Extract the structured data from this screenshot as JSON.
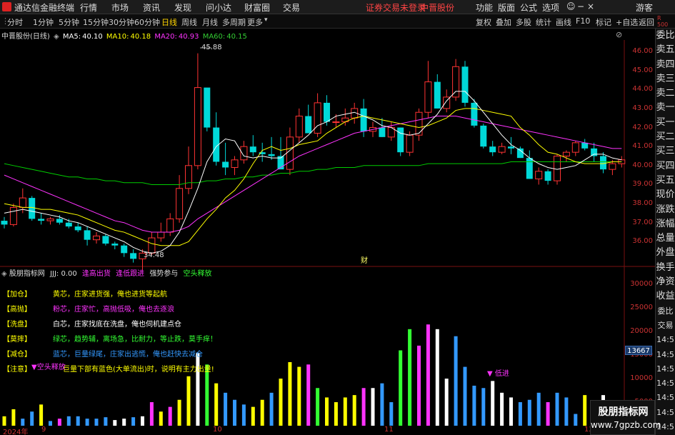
{
  "topbar": {
    "app_title": "通达信金融终端",
    "menus": [
      "行情",
      "市场",
      "资讯",
      "发现",
      "问小达",
      "财富圈",
      "交易"
    ],
    "login_notice": "证券交易未登录",
    "stock_name": "中晋股份",
    "right_menus": [
      "功能",
      "版面",
      "公式",
      "选项"
    ],
    "guest": "游客"
  },
  "tabbar": {
    "periods": [
      "分时",
      "1分钟",
      "5分钟",
      "15分钟",
      "30分钟",
      "60分钟",
      "日线",
      "周线",
      "月线",
      "多周期",
      "更多"
    ],
    "active_period": "日线",
    "right_buttons": [
      "复权",
      "叠加",
      "多股",
      "统计",
      "画线",
      "F10",
      "标记",
      "+自选",
      "返回"
    ]
  },
  "indicator_line": {
    "stock": "中晋股份(日线)",
    "ma5_label": "MA5:",
    "ma5": "40.10",
    "ma10_label": "MA10:",
    "ma10": "40.18",
    "ma20_label": "MA20:",
    "ma20": "40.93",
    "ma60_label": "MA60:",
    "ma60": "40.15"
  },
  "price_axis": [
    "46.00",
    "45.00",
    "44.00",
    "43.00",
    "42.00",
    "41.00",
    "40.00",
    "39.00",
    "38.00",
    "37.00",
    "36.00"
  ],
  "annotations": {
    "high": "45.88",
    "low": "34.48",
    "marker": "财"
  },
  "sub_panel": {
    "title": "股朋指标网",
    "jjj": "JJJ: 0.00",
    "s1": "逢高出货",
    "s2": "逢低跟进",
    "s3": "强势参与",
    "s4": "空头释放",
    "axis": [
      "30000",
      "25000",
      "20000",
      "15000",
      "10000",
      "5000"
    ],
    "highlight_value": "13667",
    "pointer_label": "低进",
    "pointer_label2": "空头释放"
  },
  "legend": [
    {
      "key": "【加仓】",
      "text": "黄芯，庄家进货强，俺也进货等起航",
      "color": "#ffff00"
    },
    {
      "key": "【高抛】",
      "text": "粉芯，庄家忙，高抛低吸，俺也去逐浪",
      "color": "#ff33ff"
    },
    {
      "key": "【洗盘】",
      "text": "白芯，庄家找底在洗盘，俺也伺机建点仓",
      "color": "#ffffff"
    },
    {
      "key": "【莫摔】",
      "text": "绿芯，趋势辅，离场急，比耐力，等止跌，莫手痒！",
      "color": "#33ff33"
    },
    {
      "key": "【减仓】",
      "text": "蓝芯，巨量绿尾，庄家出逃慌，俺也赶快去减仓",
      "color": "#3399ff"
    },
    {
      "key": "【注意】",
      "text": "巨量下部有蓝色(大单流出)时，说明有主力出量!",
      "color": "#ffff00"
    }
  ],
  "right_panel": [
    "委比",
    "卖五",
    "卖四",
    "卖三",
    "卖二",
    "卖一",
    "买一",
    "买二",
    "买三",
    "买四",
    "买五",
    "现价",
    "涨跌",
    "涨幅",
    "总量",
    "外盘",
    "换手",
    "净资",
    "收益"
  ],
  "right_panel2": [
    "委比",
    "交易",
    "14:5",
    "14:5",
    "14:5",
    "14:5",
    "14:5",
    "14:5",
    "14:5",
    "14:5"
  ],
  "dates": {
    "d1": "2024年",
    "m9": "9",
    "m10": "10",
    "m11": "11",
    "m12": "12"
  },
  "watermark": {
    "line1": "股朋指标网",
    "line2": "www.7gpzb.com"
  },
  "colors": {
    "up": "#ff3333",
    "down": "#00d8d8",
    "ma5": "#ffffff",
    "ma10": "#ffff00",
    "ma20": "#ff33ff",
    "ma60": "#00cc00"
  },
  "chart_data": {
    "type": "candlestick",
    "ylim": [
      35.0,
      46.6
    ],
    "candles": [
      [
        37.1,
        37.3,
        36.7,
        36.9
      ],
      [
        36.9,
        38.0,
        36.8,
        37.8
      ],
      [
        37.8,
        38.8,
        37.5,
        38.3
      ],
      [
        38.3,
        38.4,
        37.1,
        37.2
      ],
      [
        37.2,
        37.5,
        36.9,
        37.1
      ],
      [
        37.1,
        37.3,
        36.9,
        37.2
      ],
      [
        37.2,
        37.4,
        36.9,
        37.0
      ],
      [
        37.0,
        37.2,
        36.7,
        36.8
      ],
      [
        36.8,
        37.0,
        36.5,
        36.6
      ],
      [
        36.6,
        36.8,
        35.8,
        36.1
      ],
      [
        36.1,
        36.5,
        35.9,
        36.3
      ],
      [
        36.3,
        36.4,
        35.8,
        35.9
      ],
      [
        35.9,
        36.0,
        35.6,
        35.8
      ],
      [
        35.8,
        35.9,
        35.2,
        35.4
      ],
      [
        35.4,
        35.6,
        34.9,
        35.1
      ],
      [
        35.1,
        35.6,
        34.5,
        35.4
      ],
      [
        35.4,
        36.5,
        35.3,
        36.2
      ],
      [
        36.2,
        37.0,
        36.0,
        36.5
      ],
      [
        36.5,
        37.5,
        36.3,
        37.2
      ],
      [
        37.2,
        39.5,
        37.0,
        38.8
      ],
      [
        38.8,
        41.0,
        38.5,
        40.0
      ],
      [
        40.0,
        45.9,
        39.8,
        44.1
      ],
      [
        44.1,
        42.5,
        41.8,
        42.0
      ],
      [
        42.0,
        42.8,
        40.0,
        40.2
      ],
      [
        40.2,
        41.2,
        39.5,
        39.9
      ],
      [
        39.9,
        40.5,
        39.5,
        40.3
      ],
      [
        40.3,
        41.3,
        40.1,
        41.0
      ],
      [
        41.0,
        41.6,
        40.5,
        40.7
      ],
      [
        40.7,
        41.2,
        40.2,
        40.6
      ],
      [
        40.6,
        41.5,
        40.3,
        40.5
      ],
      [
        40.5,
        41.5,
        39.9,
        39.8
      ],
      [
        39.8,
        42.0,
        39.5,
        41.5
      ],
      [
        41.5,
        43.0,
        41.2,
        42.6
      ],
      [
        42.6,
        43.2,
        42.0,
        41.7
      ],
      [
        41.7,
        43.8,
        41.5,
        43.3
      ],
      [
        43.3,
        43.7,
        42.1,
        42.3
      ],
      [
        42.3,
        42.7,
        42.0,
        42.3
      ],
      [
        42.3,
        43.0,
        42.1,
        42.5
      ],
      [
        42.5,
        43.3,
        42.2,
        43.0
      ],
      [
        43.0,
        43.5,
        41.5,
        41.8
      ],
      [
        41.8,
        42.3,
        41.5,
        42.0
      ],
      [
        42.0,
        42.5,
        41.5,
        41.5
      ],
      [
        41.5,
        42.3,
        41.3,
        42.0
      ],
      [
        42.0,
        42.0,
        40.5,
        40.7
      ],
      [
        40.7,
        41.8,
        40.5,
        41.6
      ],
      [
        41.6,
        43.0,
        41.3,
        42.8
      ],
      [
        42.8,
        45.5,
        42.5,
        44.4
      ],
      [
        44.4,
        44.8,
        43.0,
        43.0
      ],
      [
        43.0,
        44.0,
        42.8,
        43.6
      ],
      [
        43.6,
        45.6,
        43.4,
        45.2
      ],
      [
        45.2,
        45.5,
        43.1,
        43.3
      ],
      [
        43.3,
        43.5,
        42.0,
        42.1
      ],
      [
        42.1,
        42.2,
        40.9,
        41.0
      ],
      [
        41.0,
        41.3,
        40.5,
        40.7
      ],
      [
        40.7,
        41.2,
        40.6,
        41.0
      ],
      [
        41.0,
        41.5,
        40.6,
        40.9
      ],
      [
        40.9,
        41.0,
        40.4,
        40.4
      ],
      [
        40.4,
        40.8,
        39.3,
        39.3
      ],
      [
        39.3,
        39.9,
        39.0,
        39.7
      ],
      [
        39.7,
        39.8,
        39.0,
        39.2
      ],
      [
        39.2,
        40.6,
        39.0,
        40.5
      ],
      [
        40.5,
        40.8,
        40.2,
        40.7
      ],
      [
        40.7,
        41.3,
        40.5,
        41.2
      ],
      [
        41.2,
        41.4,
        40.8,
        40.9
      ],
      [
        40.9,
        41.2,
        40.2,
        40.5
      ],
      [
        40.5,
        40.7,
        39.6,
        39.8
      ],
      [
        39.8,
        40.3,
        39.5,
        40.1
      ],
      [
        40.1,
        40.5,
        39.9,
        40.3
      ]
    ],
    "ma5": [
      37.5,
      37.6,
      37.7,
      37.6,
      37.5,
      37.4,
      37.3,
      37.1,
      37.0,
      36.8,
      36.6,
      36.4,
      36.2,
      36.0,
      35.7,
      35.5,
      35.4,
      35.5,
      35.8,
      36.5,
      37.6,
      38.8,
      40.2,
      41.0,
      41.4,
      41.3,
      40.5,
      40.4,
      40.5,
      40.4,
      40.4,
      40.8,
      41.2,
      41.6,
      42.1,
      42.3,
      42.6,
      42.7,
      42.8,
      42.6,
      42.4,
      42.1,
      42.0,
      41.7,
      41.6,
      41.7,
      42.2,
      42.7,
      43.4,
      43.9,
      43.9,
      43.4,
      42.8,
      42.2,
      41.6,
      41.1,
      40.8,
      40.4,
      40.1,
      39.9,
      39.8,
      39.9,
      40.0,
      40.3,
      40.6,
      40.6,
      40.4,
      40.3
    ],
    "ma10": [
      38.0,
      37.9,
      37.8,
      37.8,
      37.7,
      37.7,
      37.6,
      37.5,
      37.4,
      37.2,
      37.0,
      36.8,
      36.6,
      36.5,
      36.3,
      36.1,
      35.9,
      35.8,
      35.8,
      35.8,
      36.0,
      36.6,
      37.2,
      37.7,
      38.3,
      38.7,
      39.3,
      40.1,
      40.8,
      41.0,
      40.8,
      40.9,
      41.1,
      41.2,
      41.3,
      41.7,
      42.0,
      42.3,
      42.5,
      42.6,
      42.5,
      42.4,
      42.3,
      42.2,
      42.1,
      42.0,
      42.1,
      42.3,
      42.5,
      42.9,
      43.0,
      43.0,
      42.9,
      42.8,
      42.7,
      42.6,
      42.0,
      41.6,
      41.1,
      40.7,
      40.6,
      40.4,
      40.2,
      40.1,
      40.1,
      40.1,
      40.2,
      40.2
    ],
    "ma20": [
      39.5,
      39.3,
      39.1,
      38.9,
      38.7,
      38.5,
      38.3,
      38.1,
      37.9,
      37.7,
      37.5,
      37.3,
      37.1,
      37.0,
      36.8,
      36.6,
      36.5,
      36.5,
      36.5,
      36.6,
      36.8,
      37.2,
      37.5,
      37.8,
      38.1,
      38.4,
      38.7,
      39.0,
      39.3,
      39.6,
      39.9,
      40.2,
      40.5,
      40.7,
      40.9,
      41.1,
      41.3,
      41.5,
      41.7,
      41.8,
      41.9,
      42.0,
      42.1,
      42.2,
      42.3,
      42.4,
      42.5,
      42.6,
      42.6,
      42.6,
      42.5,
      42.4,
      42.3,
      42.2,
      42.1,
      42.0,
      41.9,
      41.8,
      41.7,
      41.6,
      41.5,
      41.4,
      41.3,
      41.2,
      41.1,
      41.0,
      40.9,
      40.9
    ],
    "ma60": [
      40.1,
      40.0,
      39.9,
      39.8,
      39.7,
      39.6,
      39.5,
      39.4,
      39.4,
      39.3,
      39.3,
      39.2,
      39.2,
      39.1,
      39.1,
      39.1,
      39.0,
      39.0,
      39.0,
      39.0,
      39.1,
      39.1,
      39.2,
      39.2,
      39.3,
      39.3,
      39.4,
      39.4,
      39.5,
      39.5,
      39.6,
      39.6,
      39.7,
      39.7,
      39.8,
      39.8,
      39.9,
      39.9,
      39.9,
      40.0,
      40.0,
      40.0,
      40.0,
      40.0,
      40.0,
      40.0,
      40.1,
      40.1,
      40.1,
      40.1,
      40.1,
      40.1,
      40.1,
      40.1,
      40.1,
      40.2,
      40.2,
      40.2,
      40.2,
      40.2,
      40.2,
      40.2,
      40.2,
      40.2,
      40.2,
      40.2,
      40.2,
      40.2
    ],
    "volume_ylim": [
      0,
      32000
    ],
    "volume": [
      [
        2000,
        "#ffff00"
      ],
      [
        3500,
        "#ffff00"
      ],
      [
        1500,
        "#3399ff"
      ],
      [
        3000,
        "#3399ff"
      ],
      [
        4500,
        "#ffff00"
      ],
      [
        1000,
        "#3399ff"
      ],
      [
        1500,
        "#ff33ff"
      ],
      [
        2000,
        "#3399ff"
      ],
      [
        2000,
        "#3399ff"
      ],
      [
        1500,
        "#3399ff"
      ],
      [
        1500,
        "#3399ff"
      ],
      [
        1800,
        "#3399ff"
      ],
      [
        1200,
        "#ffffff"
      ],
      [
        1500,
        "#ffffff"
      ],
      [
        1800,
        "#3399ff"
      ],
      [
        2000,
        "#ffffff"
      ],
      [
        5000,
        "#ff33ff"
      ],
      [
        3000,
        "#ffff00"
      ],
      [
        4000,
        "#ff33ff"
      ],
      [
        5500,
        "#ffff00"
      ],
      [
        10500,
        "#ffff00"
      ],
      [
        15500,
        "#ffffff"
      ],
      [
        13000,
        "#33ff33"
      ],
      [
        9000,
        "#ffff00"
      ],
      [
        7000,
        "#3399ff"
      ],
      [
        5500,
        "#3399ff"
      ],
      [
        4500,
        "#3399ff"
      ],
      [
        4000,
        "#ffff00"
      ],
      [
        5500,
        "#ffff00"
      ],
      [
        7000,
        "#3399ff"
      ],
      [
        10000,
        "#ffff00"
      ],
      [
        13500,
        "#ffff00"
      ],
      [
        12500,
        "#ffff00"
      ],
      [
        13000,
        "#ff33ff"
      ],
      [
        8000,
        "#33ff33"
      ],
      [
        6000,
        "#ffff00"
      ],
      [
        5000,
        "#ffff00"
      ],
      [
        6000,
        "#ffff00"
      ],
      [
        6500,
        "#ffff00"
      ],
      [
        8000,
        "#ff33ff"
      ],
      [
        8000,
        "#ffffff"
      ],
      [
        9000,
        "#3399ff"
      ],
      [
        5000,
        "#3399ff"
      ],
      [
        16000,
        "#33ff33"
      ],
      [
        20500,
        "#33ff33"
      ],
      [
        17000,
        "#ff33ff"
      ],
      [
        21500,
        "#ff33ff"
      ],
      [
        20500,
        "#ffffff"
      ],
      [
        10000,
        "#ffffff"
      ],
      [
        19000,
        "#3399ff"
      ],
      [
        12500,
        "#3399ff"
      ],
      [
        8500,
        "#3399ff"
      ],
      [
        8000,
        "#3399ff"
      ],
      [
        9500,
        "#ffffff"
      ],
      [
        7000,
        "#ffffff"
      ],
      [
        6000,
        "#ffffff"
      ],
      [
        5000,
        "#3399ff"
      ],
      [
        5500,
        "#3399ff"
      ],
      [
        7000,
        "#3399ff"
      ],
      [
        5000,
        "#ff33ff"
      ],
      [
        7000,
        "#3399ff"
      ],
      [
        6000,
        "#3399ff"
      ],
      [
        2500,
        "#3399ff"
      ],
      [
        6500,
        "#ffff00"
      ],
      [
        4500,
        "#3399ff"
      ],
      [
        6500,
        "#ffffff"
      ],
      [
        4000,
        "#3399ff"
      ],
      [
        2000,
        "#3399ff"
      ]
    ]
  }
}
